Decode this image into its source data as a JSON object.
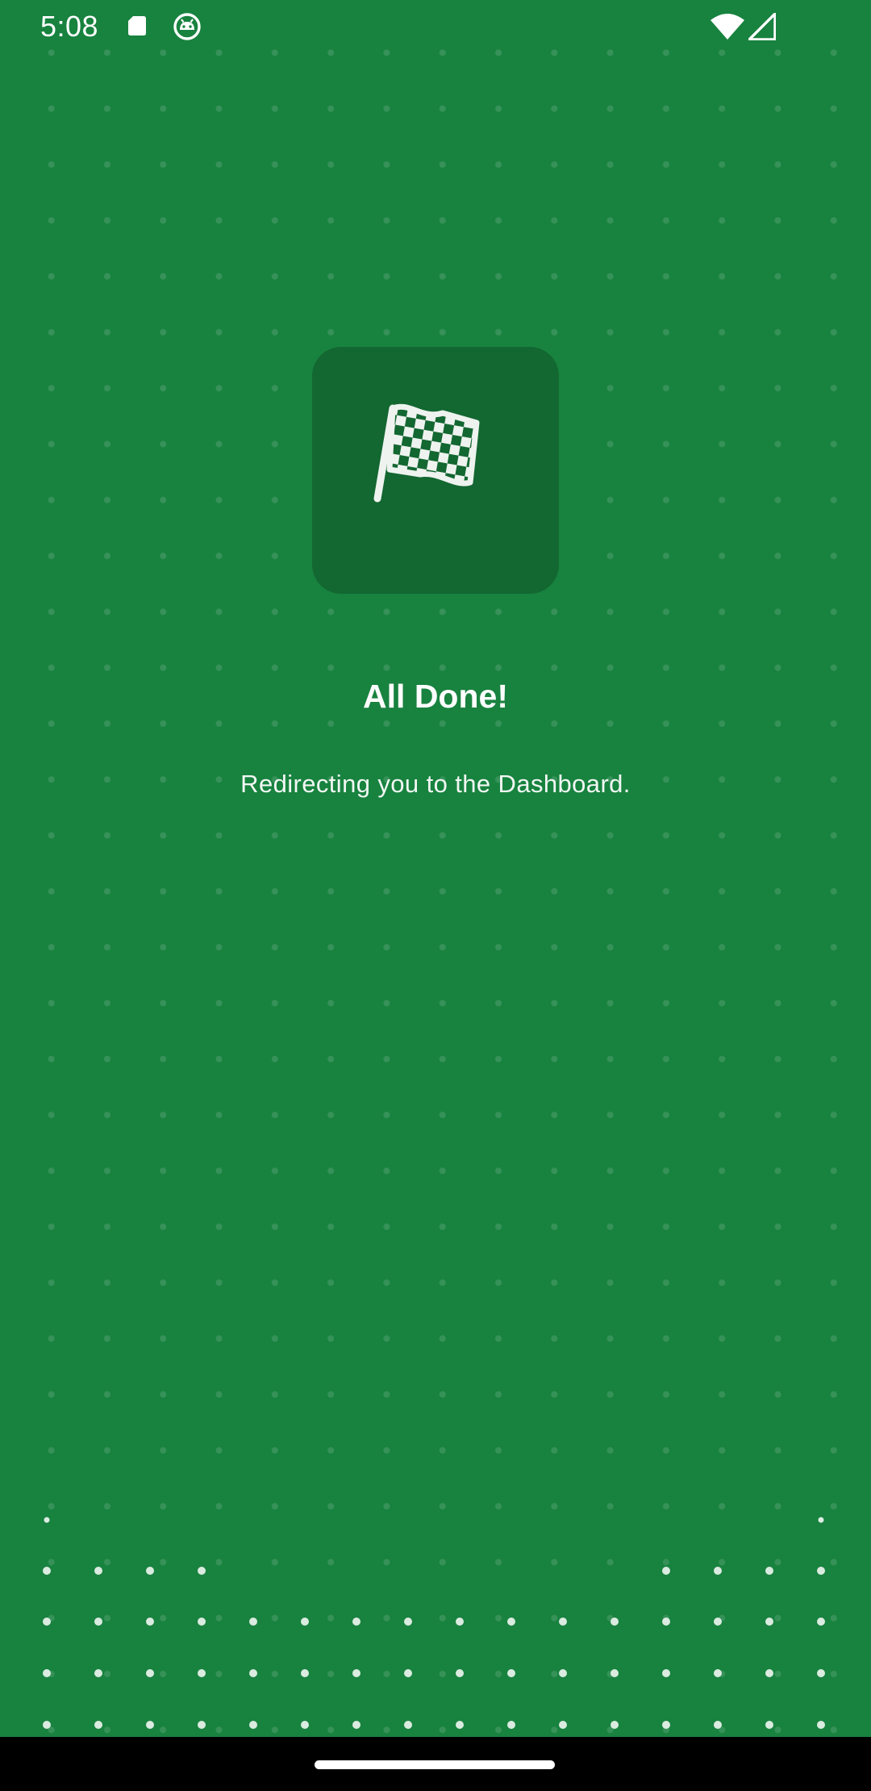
{
  "status_bar": {
    "time": "5:08",
    "icons": [
      "sd-card-icon",
      "android-robot-icon",
      "wifi-icon",
      "signal-icon"
    ]
  },
  "main": {
    "badge_icon": "checkered-flag-icon",
    "title": "All Done!",
    "subtitle": "Redirecting you to the Dashboard."
  },
  "colors": {
    "background": "#18823f",
    "badge": "#136731",
    "text": "#ffffff",
    "nav_bar": "#000000"
  }
}
